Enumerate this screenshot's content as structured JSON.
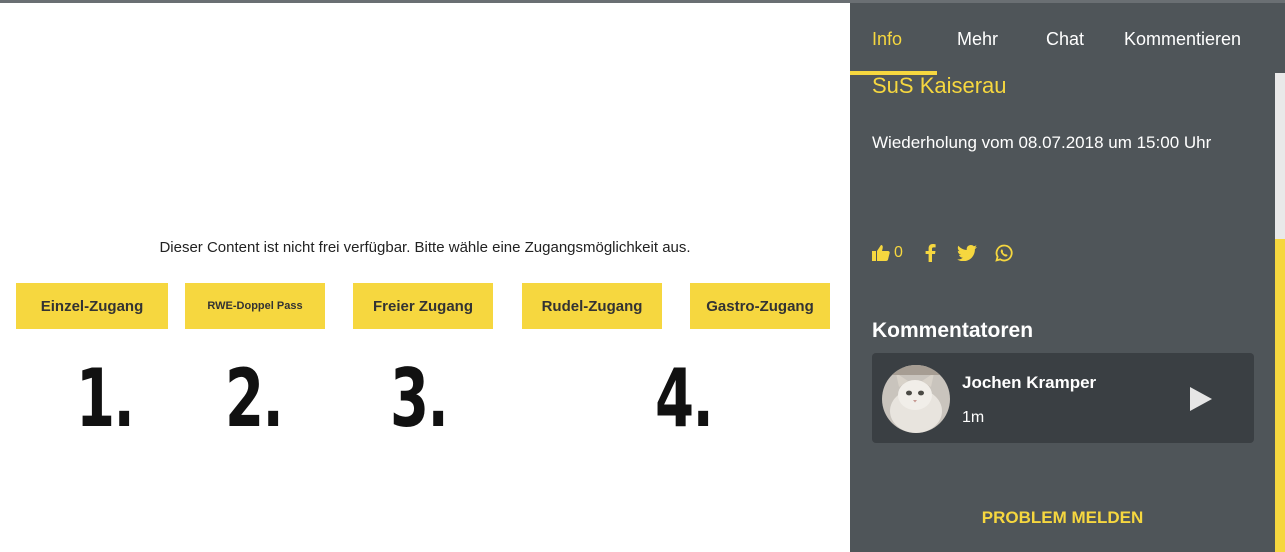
{
  "main": {
    "notice": "Dieser Content ist nicht frei verfügbar. Bitte wähle eine Zugangsmöglichkeit aus.",
    "access_options": [
      {
        "label": "Einzel-Zugang"
      },
      {
        "label": "RWE-Doppel Pass"
      },
      {
        "label": "Freier Zugang"
      },
      {
        "label": "Rudel-Zugang"
      },
      {
        "label": "Gastro-Zugang"
      }
    ],
    "markers": [
      "1.",
      "2.",
      "3.",
      "4."
    ]
  },
  "panel": {
    "tabs": [
      {
        "label": "Info",
        "active": true
      },
      {
        "label": "Mehr"
      },
      {
        "label": "Chat"
      },
      {
        "label": "Kommentieren"
      }
    ],
    "match_title": "SuS Kaiserau",
    "replay_text": "Wiederholung vom 08.07.2018 um 15:00 Uhr",
    "likes": "0",
    "social_icons": [
      "thumbs-up-icon",
      "facebook-icon",
      "twitter-icon",
      "whatsapp-icon"
    ],
    "commentators_title": "Kommentatoren",
    "commentator": {
      "name": "Jochen Kramper",
      "duration": "1m"
    },
    "problem_label": "PROBLEM MELDEN"
  },
  "colors": {
    "accent": "#f6d73f",
    "panel_bg": "#4f5559",
    "card_bg": "#3a3f43"
  }
}
